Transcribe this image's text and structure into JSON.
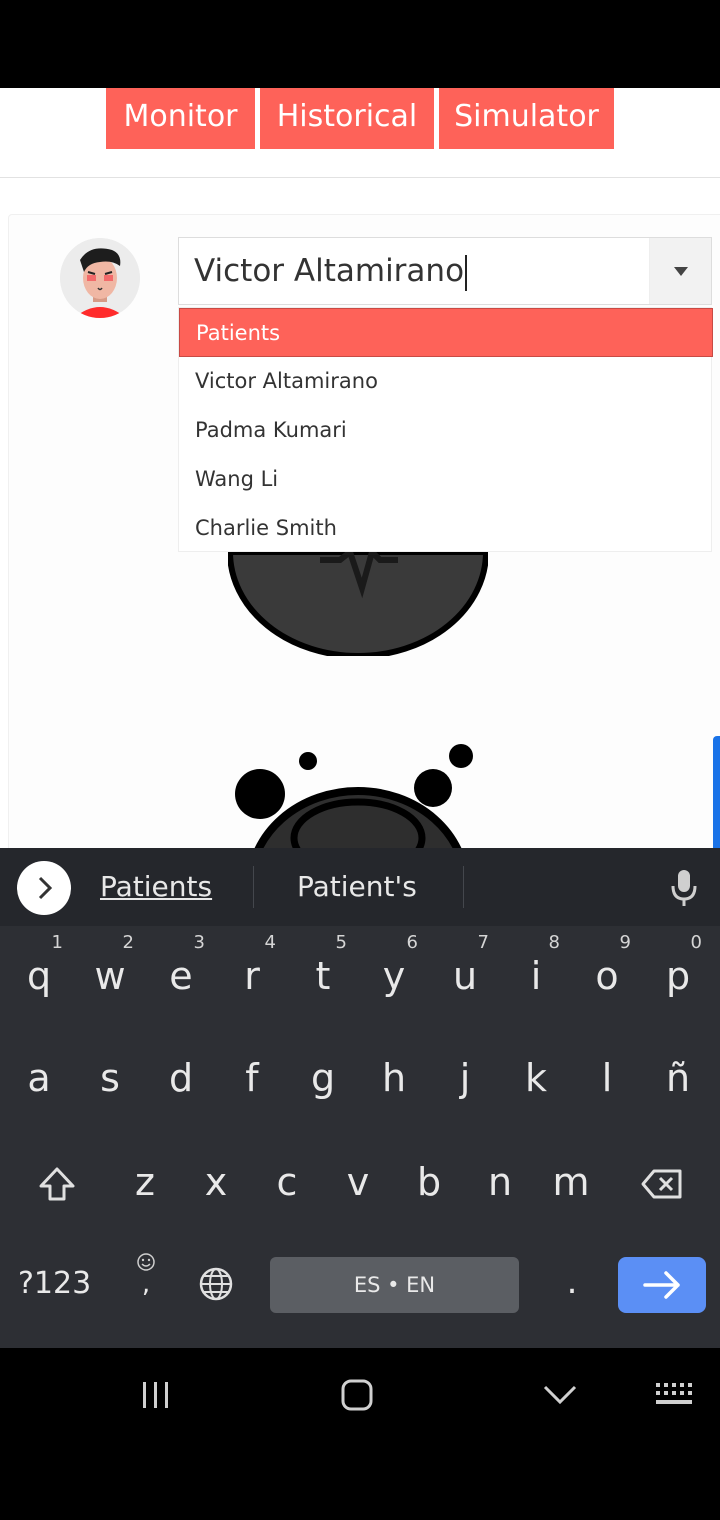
{
  "tabs": [
    {
      "label": "Monitor"
    },
    {
      "label": "Historical"
    },
    {
      "label": "Simulator"
    }
  ],
  "patient_select": {
    "value": "Victor Altamirano",
    "header": "Patients",
    "options": [
      "Victor Altamirano",
      "Padma Kumari",
      "Wang Li",
      "Charlie Smith"
    ]
  },
  "keyboard": {
    "suggestions": [
      "Patients",
      "Patient's"
    ],
    "row1": [
      {
        "key": "q",
        "hint": "1"
      },
      {
        "key": "w",
        "hint": "2"
      },
      {
        "key": "e",
        "hint": "3"
      },
      {
        "key": "r",
        "hint": "4"
      },
      {
        "key": "t",
        "hint": "5"
      },
      {
        "key": "y",
        "hint": "6"
      },
      {
        "key": "u",
        "hint": "7"
      },
      {
        "key": "i",
        "hint": "8"
      },
      {
        "key": "o",
        "hint": "9"
      },
      {
        "key": "p",
        "hint": "0"
      }
    ],
    "row2": [
      "a",
      "s",
      "d",
      "f",
      "g",
      "h",
      "j",
      "k",
      "l",
      "ñ"
    ],
    "row3": [
      "z",
      "x",
      "c",
      "v",
      "b",
      "n",
      "m"
    ],
    "symbols_label": "?123",
    "comma_label": ",",
    "space_label": "ES • EN",
    "period_label": "."
  },
  "colors": {
    "accent": "#fe6259",
    "enter_key": "#5b8ff5",
    "keyboard_bg": "#2d2f34"
  }
}
